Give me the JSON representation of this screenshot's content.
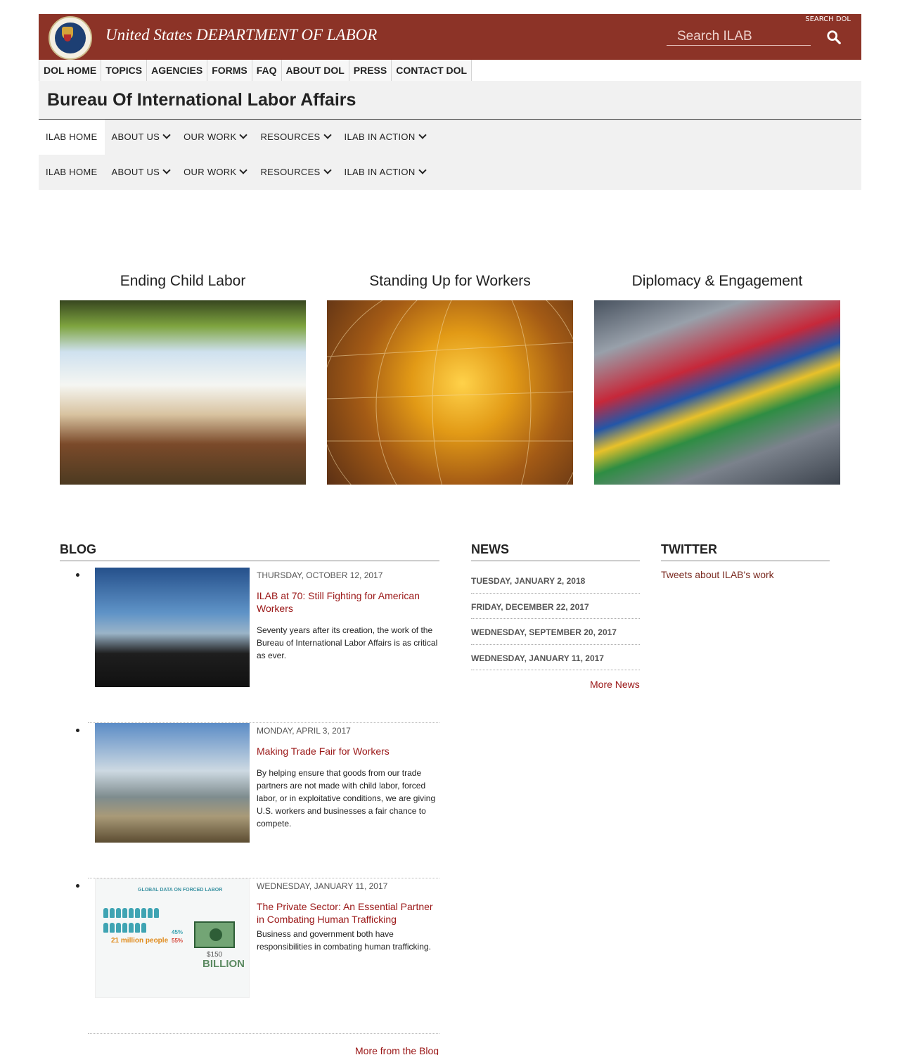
{
  "header": {
    "title": "United States DEPARTMENT OF LABOR",
    "search_dol_label": "SEARCH DOL",
    "search_placeholder": "Search ILAB"
  },
  "top_nav": [
    "DOL HOME",
    "TOPICS",
    "AGENCIES",
    "FORMS",
    "FAQ",
    "ABOUT DOL",
    "PRESS",
    "CONTACT DOL"
  ],
  "bureau_title": "Bureau Of International Labor Affairs",
  "sub_nav": [
    "ILAB HOME",
    "ABOUT US",
    "OUR WORK",
    "RESOURCES",
    "ILAB IN ACTION"
  ],
  "features": [
    {
      "title": "Ending Child Labor"
    },
    {
      "title": "Standing Up for Workers"
    },
    {
      "title": "Diplomacy & Engagement"
    }
  ],
  "blog": {
    "heading": "BLOG",
    "posts": [
      {
        "date": "THURSDAY, OCTOBER 12, 2017",
        "title": "ILAB at 70: Still Fighting for American Workers",
        "desc": "Seventy years after its creation, the work of the Bureau of International Labor Affairs is as critical as ever."
      },
      {
        "date": "MONDAY, APRIL 3, 2017",
        "title": "Making Trade Fair for Workers",
        "desc": "By helping ensure that goods from our trade partners are not made with child labor, forced labor, or in exploitative conditions, we are giving U.S. workers and businesses a fair chance to compete."
      },
      {
        "date": "WEDNESDAY, JANUARY 11, 2017",
        "title": "The Private Sector: An Essential Partner in Combating Human Trafficking",
        "desc": "Business and government both have responsibilities in combating human trafficking."
      }
    ],
    "infographic": {
      "title": "GLOBAL DATA ON FORCED LABOR",
      "people": "21 million people",
      "pct_male": "45%",
      "pct_female": "55%",
      "amount": "$150",
      "billion": "BILLION"
    },
    "more": "More from the Blog"
  },
  "news": {
    "heading": "NEWS",
    "dates": [
      "TUESDAY, JANUARY 2, 2018",
      "FRIDAY, DECEMBER 22, 2017",
      "WEDNESDAY, SEPTEMBER 20, 2017",
      "WEDNESDAY, JANUARY 11, 2017"
    ],
    "more": "More News"
  },
  "twitter": {
    "heading": "TWITTER",
    "link": "Tweets about ILAB's work"
  }
}
